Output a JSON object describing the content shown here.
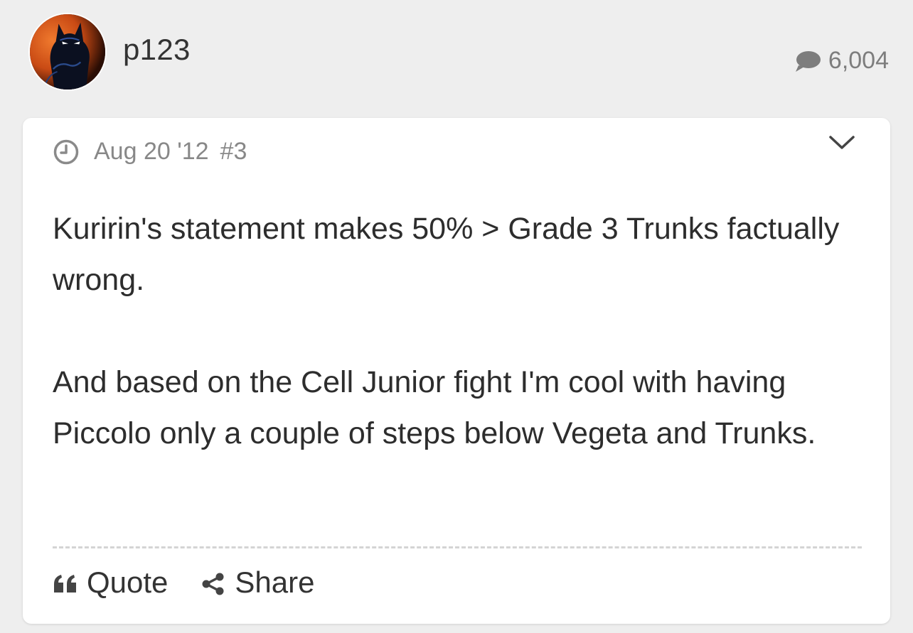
{
  "author": {
    "username": "p123",
    "post_count": "6,004",
    "post_count_icon": "speech-bubble-icon",
    "avatar": "batman-avatar"
  },
  "post": {
    "date": "Aug 20 '12",
    "number": "#3",
    "date_icon": "clock-icon",
    "menu_icon": "chevron-down-icon",
    "paragraphs": [
      "Kuririn's statement makes 50% > Grade 3 Trunks factually wrong.",
      "And based on the Cell Junior fight I'm cool with having Piccolo only a couple of steps below Vegeta and Trunks."
    ],
    "actions": {
      "quote_label": "Quote",
      "quote_icon": "quote-icon",
      "share_label": "Share",
      "share_icon": "share-icon"
    }
  },
  "colors": {
    "background": "#eeeeee",
    "card": "#ffffff",
    "muted_text": "#888888",
    "avatar_accent": "#e8632a"
  }
}
